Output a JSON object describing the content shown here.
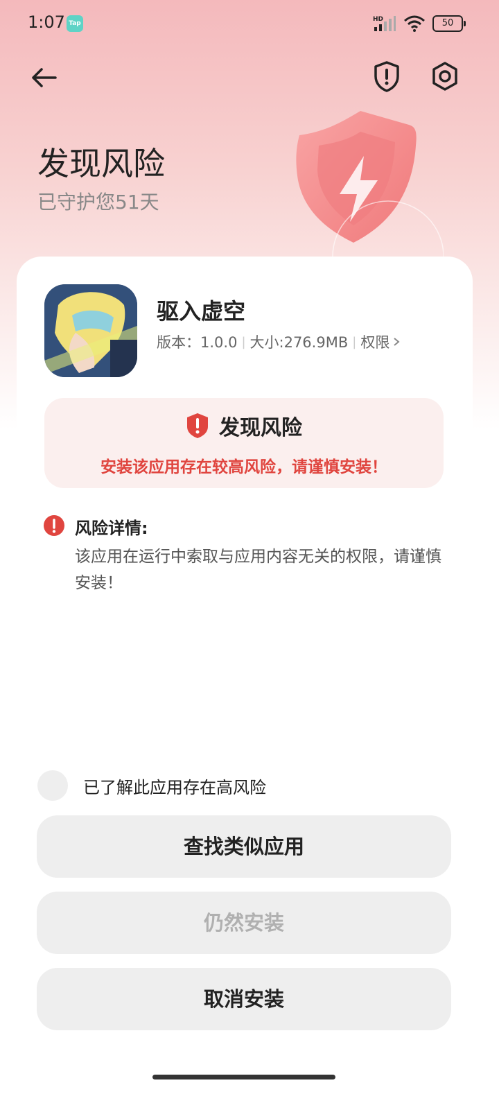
{
  "status_bar": {
    "time": "1:07",
    "tap_badge": "Tap",
    "battery": "50",
    "signal_label": "HD"
  },
  "header": {
    "title": "发现风险",
    "subtitle": "已守护您51天"
  },
  "app": {
    "name": "驱入虚空",
    "version": "版本：1.0.0",
    "size": "大小:276.9MB",
    "permissions": "权限"
  },
  "risk_box": {
    "title": "发现风险",
    "warning": "安装该应用存在较高风险，请谨慎安装！"
  },
  "details": {
    "title": "风险详情:",
    "text": "该应用在运行中索取与应用内容无关的权限，请谨慎安装！"
  },
  "acknowledge": {
    "label": "已了解此应用存在高风险"
  },
  "buttons": {
    "find_similar": "查找类似应用",
    "install_anyway": "仍然安装",
    "cancel": "取消安装"
  },
  "colors": {
    "risk_red": "#e0453f",
    "hero_pink": "#f4b9bc"
  },
  "icons": [
    "back-arrow-icon",
    "shield-alert-icon",
    "settings-gear-icon",
    "risk-shield-icon",
    "info-alert-icon",
    "chevron-right-icon"
  ]
}
